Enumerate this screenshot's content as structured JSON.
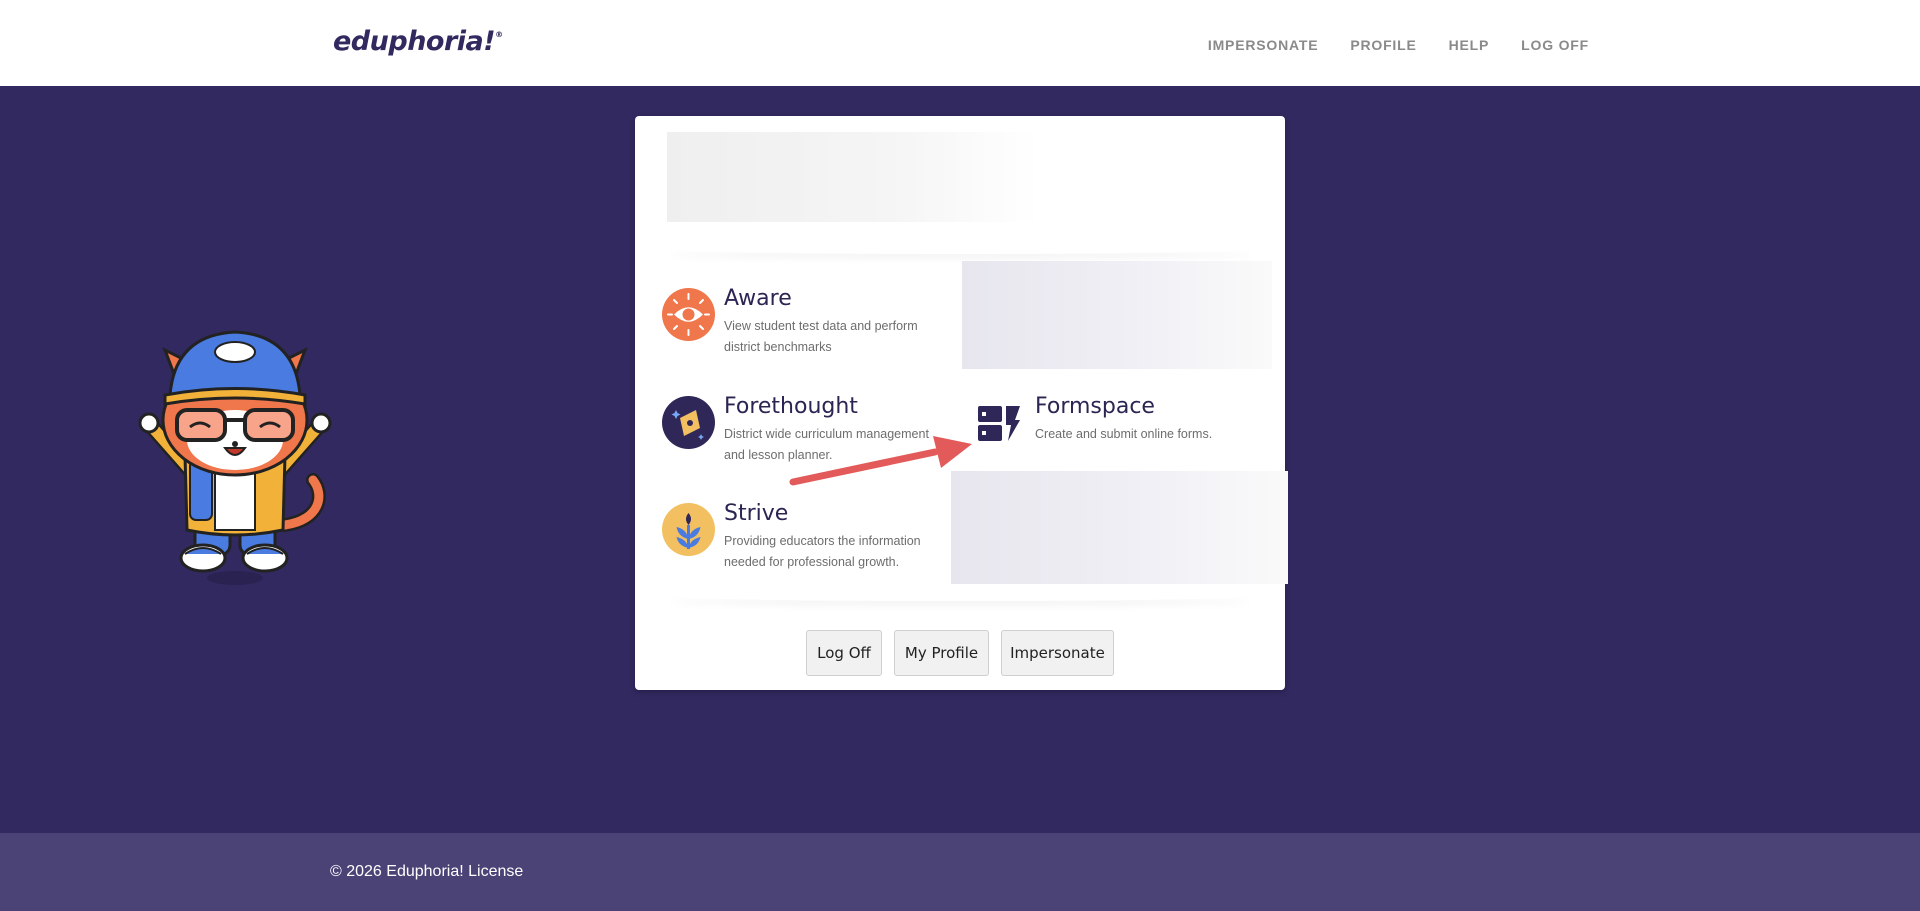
{
  "header": {
    "logo_text": "eduphoria!",
    "logo_mark": "®",
    "nav": [
      {
        "label": "IMPERSONATE"
      },
      {
        "label": "PROFILE"
      },
      {
        "label": "HELP"
      },
      {
        "label": "LOG OFF"
      }
    ]
  },
  "apps": [
    {
      "name": "Aware",
      "desc": "View student test data and perform district benchmarks",
      "icon": "eye-icon",
      "color": "#f0764b"
    },
    {
      "name": "Forethought",
      "desc": "District wide curriculum management and lesson planner.",
      "icon": "compass-icon",
      "color": "#2f2757"
    },
    {
      "name": "Strive",
      "desc": "Providing educators the information needed for professional growth.",
      "icon": "wheat-icon",
      "color": "#f2c061"
    },
    {
      "name": "Formspace",
      "desc": "Create and submit online forms.",
      "icon": "formspace-icon",
      "color": "#2f2757"
    }
  ],
  "buttons": {
    "log_off": "Log Off",
    "my_profile": "My Profile",
    "impersonate": "Impersonate"
  },
  "footer": {
    "text": "© 2026 Eduphoria! License"
  },
  "colors": {
    "brand_dark": "#322960",
    "footer_bg": "#4b4276",
    "annotation_arrow": "#e35a5a"
  }
}
